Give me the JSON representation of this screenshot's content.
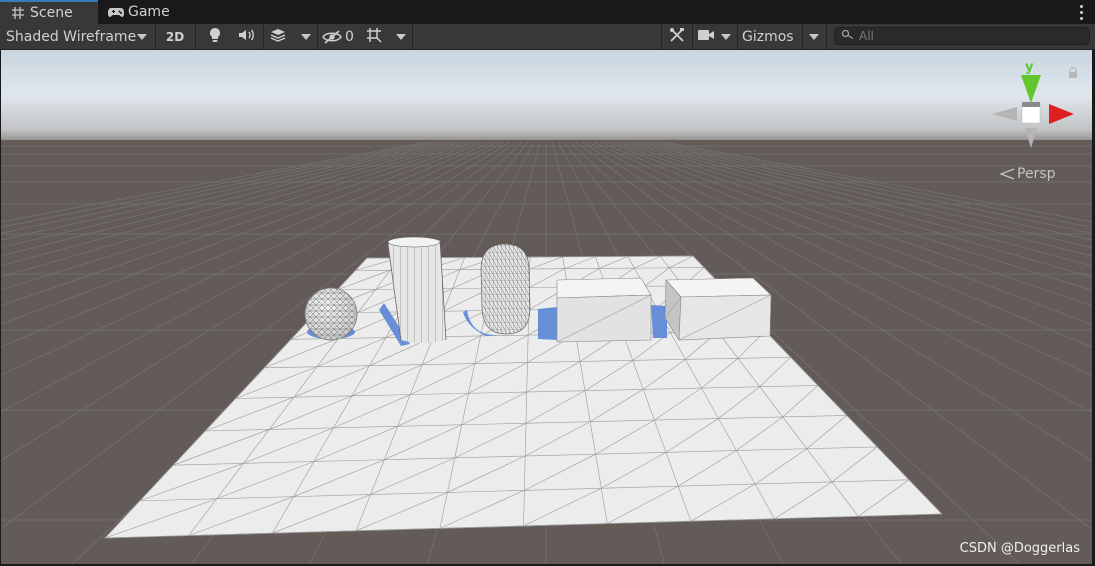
{
  "tabs": [
    {
      "label": "Scene",
      "icon": "grid-hash-icon",
      "active": true
    },
    {
      "label": "Game",
      "icon": "gamepad-icon",
      "active": false
    }
  ],
  "toolbar": {
    "shading_mode": "Shaded Wireframe",
    "btn_2d": "2D",
    "hidden_count": "0",
    "gizmos": "Gizmos",
    "search_placeholder": "All"
  },
  "viewport": {
    "axis_label": "y",
    "projection": "Persp",
    "watermark": "CSDN @Doggerlas"
  },
  "colors": {
    "tab_active_accent": "#3a79bb",
    "toolbar_bg": "#383838",
    "ground": "#625b58",
    "sky": "#c9d7e2",
    "plane": "#ececec",
    "axis_y": "#62c62f",
    "axis_x": "#e02020"
  }
}
